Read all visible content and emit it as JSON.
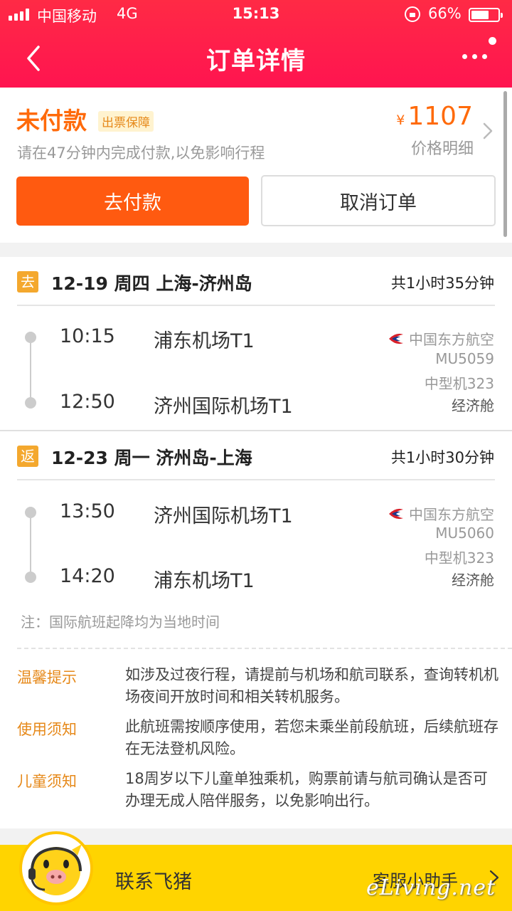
{
  "status_bar": {
    "carrier": "中国移动",
    "network": "4G",
    "time": "15:13",
    "battery": "66%",
    "battery_level": 0.66
  },
  "nav": {
    "title": "订单详情",
    "back_icon": "chevron-left-icon",
    "more_icon": "more-dots-icon"
  },
  "payment": {
    "status": "未付款",
    "guarantee_badge": "出票保障",
    "deadline": "请在47分钟内完成付款,以免影响行程",
    "currency": "¥",
    "amount": "1107",
    "price_detail": "价格明细",
    "pay_button": "去付款",
    "cancel_button": "取消订单"
  },
  "segments": [
    {
      "tag": "去",
      "title": "12-19 周四 上海-济州岛",
      "duration": "共1小时35分钟",
      "depart_time": "10:15",
      "depart_airport": "浦东机场T1",
      "arrive_time": "12:50",
      "arrive_airport": "济州国际机场T1",
      "airline": "中国东方航空",
      "flight_no": "MU5059",
      "aircraft": "中型机323",
      "cabin": "经济舱"
    },
    {
      "tag": "返",
      "title": "12-23 周一 济州岛-上海",
      "duration": "共1小时30分钟",
      "depart_time": "13:50",
      "depart_airport": "济州国际机场T1",
      "arrive_time": "14:20",
      "arrive_airport": "浦东机场T1",
      "airline": "中国东方航空",
      "flight_no": "MU5060",
      "aircraft": "中型机323",
      "cabin": "经济舱"
    }
  ],
  "note": "注：国际航班起降均为当地时间",
  "tips": [
    {
      "label": "温馨提示",
      "text": "如涉及过夜行程，请提前与机场和航司联系，查询转机机场夜间开放时间和相关转机服务。"
    },
    {
      "label": "使用须知",
      "text": "此航班需按顺序使用，若您未乘坐前段航班，后续航班存在无法登机风险。"
    },
    {
      "label": "儿童须知",
      "text": "18周岁以下儿童单独乘机，购票前请与航司确认是否可办理无成人陪伴服务，以免影响出行。"
    }
  ],
  "footer": {
    "contact": "联系飞猪",
    "service": "客服小助手",
    "watermark": "eLiving.net"
  },
  "colors": {
    "header": "#ff1a4b",
    "accent_orange": "#ff5a10",
    "tip_label": "#e6891a",
    "footer_bar": "#ffd400"
  }
}
